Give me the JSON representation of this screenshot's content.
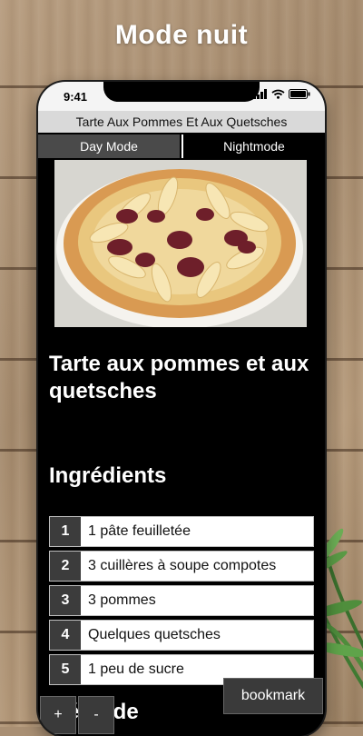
{
  "headline": "Mode nuit",
  "status": {
    "time": "9:41"
  },
  "app": {
    "title": "Tarte Aux Pommes Et Aux Quetsches",
    "modes": {
      "day": "Day Mode",
      "night": "Nightmode",
      "active": "night"
    }
  },
  "recipe": {
    "title": "Tarte aux pommes et aux quetsches",
    "ingredients_heading": "Ingrédients",
    "ingredients": [
      {
        "num": "1",
        "text": "1 pâte feuilletée"
      },
      {
        "num": "2",
        "text": "3 cuillères à soupe compotes"
      },
      {
        "num": "3",
        "text": "3 pommes"
      },
      {
        "num": "4",
        "text": "Quelques quetsches"
      },
      {
        "num": "5",
        "text": "1 peu de sucre"
      }
    ],
    "method_heading": "Méthode"
  },
  "controls": {
    "plus": "+",
    "minus": "-",
    "bookmark": "bookmark"
  },
  "colors": {
    "accent_dark": "#3a3a3a",
    "background": "#000000"
  },
  "icons": [
    "signal-icon",
    "wifi-icon",
    "battery-icon"
  ]
}
